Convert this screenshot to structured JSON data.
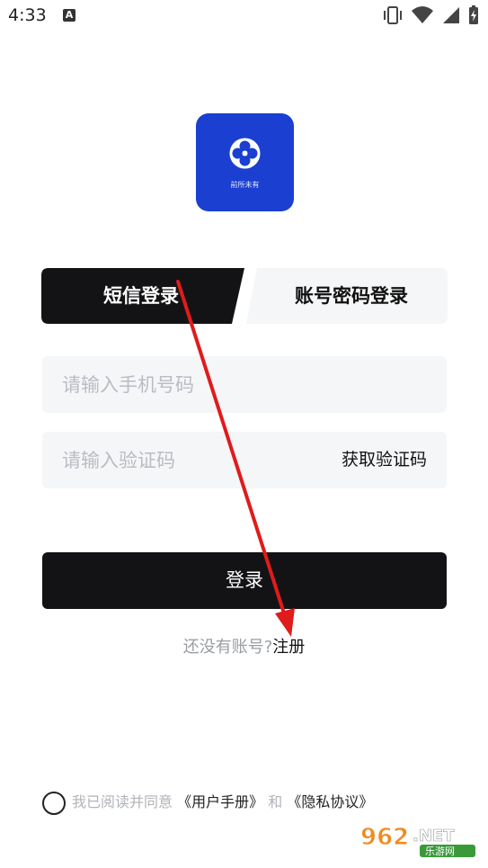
{
  "status_bar": {
    "time": "4:33",
    "notification_letter": "A"
  },
  "logo": {
    "caption": "前所未有"
  },
  "tabs": {
    "sms_login": "短信登录",
    "password_login": "账号密码登录"
  },
  "phone_field": {
    "placeholder": "请输入手机号码",
    "value": ""
  },
  "code_field": {
    "placeholder": "请输入验证码",
    "value": "",
    "get_code_label": "获取验证码"
  },
  "login_button": {
    "label": "登录"
  },
  "register": {
    "prompt": "还没有账号?",
    "link": "注册"
  },
  "agreement": {
    "prefix": "我已阅读并同意",
    "user_manual": "《用户手册》",
    "and": "和",
    "privacy": "《隐私协议》"
  },
  "watermark": {
    "text": "962.NET",
    "sub": "乐游网"
  },
  "colors": {
    "brand_blue": "#1a3fd1",
    "dark": "#131316",
    "field_bg": "#f5f6f8",
    "arrow": "#e01b1b"
  }
}
